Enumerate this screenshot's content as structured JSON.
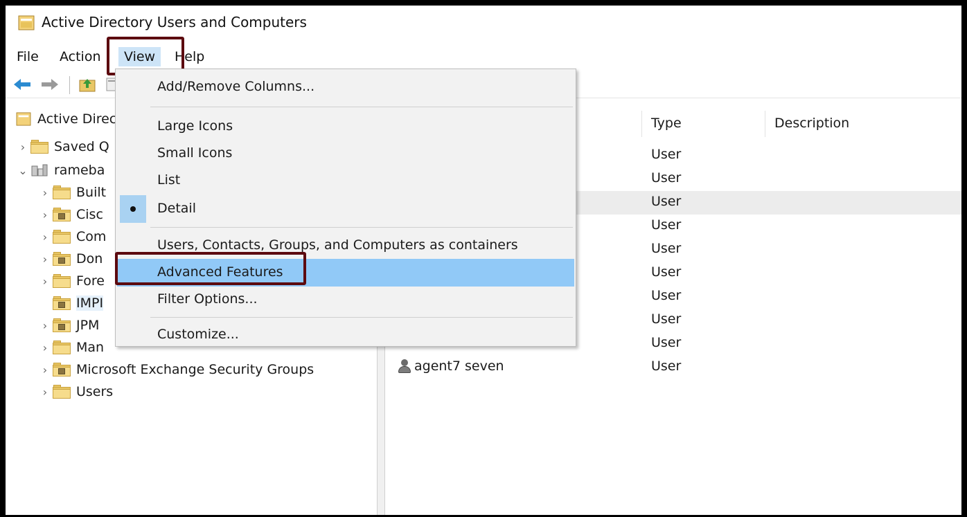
{
  "window": {
    "title": "Active Directory Users and Computers"
  },
  "menubar": {
    "items": [
      {
        "label": "File"
      },
      {
        "label": "Action"
      },
      {
        "label": "View"
      },
      {
        "label": "Help"
      }
    ]
  },
  "tree": {
    "root": "Active Direc",
    "saved": "Saved Q",
    "domain": "rameba",
    "children": [
      {
        "label": "Built"
      },
      {
        "label": "Cisc"
      },
      {
        "label": "Com"
      },
      {
        "label": "Don"
      },
      {
        "label": "Fore"
      },
      {
        "label": "IMPI"
      },
      {
        "label": "JPM"
      },
      {
        "label": "Man"
      },
      {
        "label": "Microsoft Exchange Security Groups"
      },
      {
        "label": "Users"
      }
    ]
  },
  "list": {
    "columns": {
      "type": "Type",
      "description": "Description"
    },
    "rows": [
      {
        "type": "User"
      },
      {
        "type": "User"
      },
      {
        "type": "User"
      },
      {
        "type": "User"
      },
      {
        "type": "User"
      },
      {
        "type": "User"
      },
      {
        "type": "User"
      },
      {
        "type": "User"
      },
      {
        "type": "User"
      },
      {
        "name": "agent7 seven",
        "type": "User"
      }
    ]
  },
  "view_menu": {
    "add_remove_columns": "Add/Remove Columns...",
    "large_icons": "Large Icons",
    "small_icons": "Small Icons",
    "list": "List",
    "detail": "Detail",
    "containers": "Users, Contacts, Groups, and Computers as containers",
    "advanced_features": "Advanced Features",
    "filter_options": "Filter Options...",
    "customize": "Customize..."
  },
  "colors": {
    "highlight": "#91c9f7",
    "annotation": "#5c0a0f",
    "folder": "#f6dc8c"
  }
}
